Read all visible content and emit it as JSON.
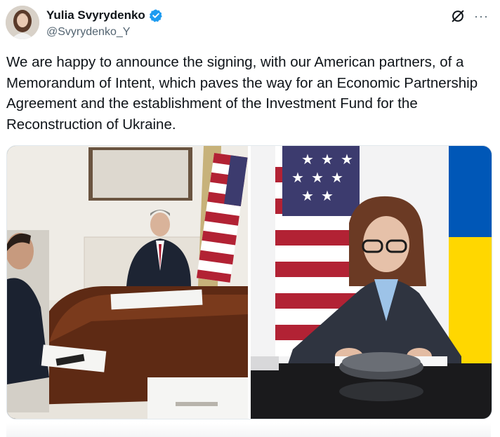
{
  "author": {
    "display_name": "Yulia Svyrydenko",
    "handle": "@Svyrydenko_Y",
    "verified": true,
    "avatar_icon": "user-avatar",
    "verified_color": "#1d9bf0"
  },
  "actions": {
    "grok_icon": "grok-icon",
    "more_label": "···"
  },
  "tweet": {
    "text": "We are happy to announce the signing, with our American partners, of a Memorandum of Intent, which paves the way for an Economic Partnership Agreement and the establishment of the Investment Fund for the Reconstruction of Ukraine."
  },
  "media": {
    "count": 2,
    "items": [
      {
        "name": "photo-signing-video-call",
        "kind": "photo"
      },
      {
        "name": "photo-minister-signing",
        "kind": "photo"
      }
    ]
  },
  "colors": {
    "text": "#0f1419",
    "secondary": "#536471",
    "accent": "#1d9bf0",
    "us_red": "#b22234",
    "us_blue": "#3c3b6e",
    "ua_blue": "#0057b7",
    "ua_yellow": "#ffd700"
  }
}
